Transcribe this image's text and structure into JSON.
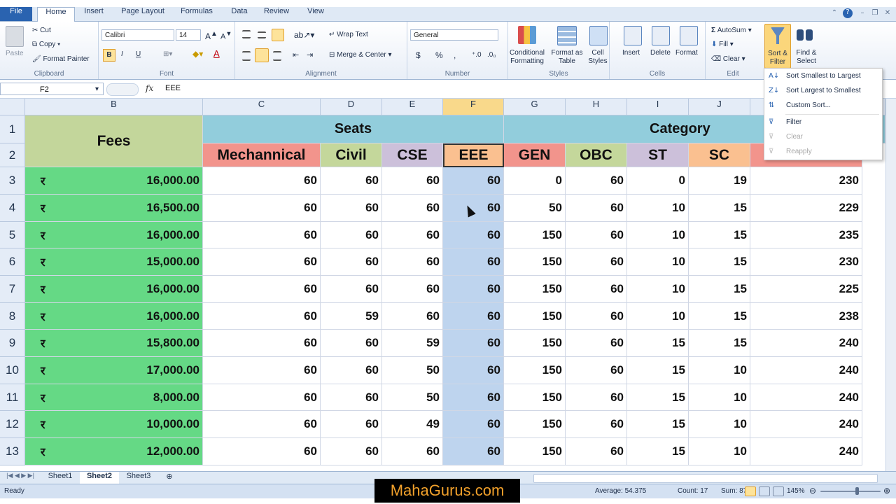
{
  "ribbon_tabs": [
    "File",
    "Home",
    "Insert",
    "Page Layout",
    "Formulas",
    "Data",
    "Review",
    "View"
  ],
  "clipboard": {
    "paste": "Paste",
    "cut": "Cut",
    "copy": "Copy",
    "format_painter": "Format Painter",
    "label": "Clipboard"
  },
  "font": {
    "name": "Calibri",
    "size": "14",
    "label": "Font",
    "bold": "B",
    "italic": "I",
    "underline": "U"
  },
  "alignment": {
    "wrap": "Wrap Text",
    "merge": "Merge & Center",
    "label": "Alignment"
  },
  "number": {
    "format": "General",
    "currency": "$",
    "percent": "%",
    "comma": ",",
    "label": "Number"
  },
  "styles": {
    "conditional": "Conditional Formatting",
    "format_table": "Format as Table",
    "cell_styles": "Cell Styles",
    "label": "Styles"
  },
  "cells": {
    "insert": "Insert",
    "delete": "Delete",
    "format": "Format",
    "label": "Cells"
  },
  "editing": {
    "autosum": "AutoSum",
    "fill": "Fill",
    "clear": "Clear",
    "sort_filter": "Sort & Filter",
    "find_select": "Find & Select",
    "label": "Edit"
  },
  "formula_bar": {
    "name_box": "F2",
    "fx": "fx",
    "content": "EEE"
  },
  "columns": [
    "B",
    "C",
    "D",
    "E",
    "F",
    "G",
    "H",
    "I",
    "J"
  ],
  "rows": [
    "1",
    "2",
    "3",
    "4",
    "5",
    "6",
    "7",
    "8",
    "9",
    "10",
    "11",
    "12",
    "13"
  ],
  "header_row1": {
    "fees": "Fees",
    "seats": "Seats",
    "category": "Category"
  },
  "header_row2": [
    "Mechannical",
    "Civil",
    "CSE",
    "EEE",
    "GEN",
    "OBC",
    "ST",
    "SC"
  ],
  "rupee": "र",
  "data_rows": [
    {
      "fee": "16,000.00",
      "c": "60",
      "d": "60",
      "e": "60",
      "f": "60",
      "g": "0",
      "h": "60",
      "i": "0",
      "j": "19",
      "k": "230"
    },
    {
      "fee": "16,500.00",
      "c": "60",
      "d": "60",
      "e": "60",
      "f": "60",
      "g": "50",
      "h": "60",
      "i": "10",
      "j": "15",
      "k": "229"
    },
    {
      "fee": "16,000.00",
      "c": "60",
      "d": "60",
      "e": "60",
      "f": "60",
      "g": "150",
      "h": "60",
      "i": "10",
      "j": "15",
      "k": "235"
    },
    {
      "fee": "15,000.00",
      "c": "60",
      "d": "60",
      "e": "60",
      "f": "60",
      "g": "150",
      "h": "60",
      "i": "10",
      "j": "15",
      "k": "230"
    },
    {
      "fee": "16,000.00",
      "c": "60",
      "d": "60",
      "e": "60",
      "f": "60",
      "g": "150",
      "h": "60",
      "i": "10",
      "j": "15",
      "k": "225"
    },
    {
      "fee": "16,000.00",
      "c": "60",
      "d": "59",
      "e": "60",
      "f": "60",
      "g": "150",
      "h": "60",
      "i": "10",
      "j": "15",
      "k": "238"
    },
    {
      "fee": "15,800.00",
      "c": "60",
      "d": "60",
      "e": "59",
      "f": "60",
      "g": "150",
      "h": "60",
      "i": "15",
      "j": "15",
      "k": "240"
    },
    {
      "fee": "17,000.00",
      "c": "60",
      "d": "60",
      "e": "50",
      "f": "60",
      "g": "150",
      "h": "60",
      "i": "15",
      "j": "10",
      "k": "240"
    },
    {
      "fee": "8,000.00",
      "c": "60",
      "d": "60",
      "e": "50",
      "f": "60",
      "g": "150",
      "h": "60",
      "i": "15",
      "j": "10",
      "k": "240"
    },
    {
      "fee": "10,000.00",
      "c": "60",
      "d": "60",
      "e": "49",
      "f": "60",
      "g": "150",
      "h": "60",
      "i": "15",
      "j": "10",
      "k": "240"
    },
    {
      "fee": "12,000.00",
      "c": "60",
      "d": "60",
      "e": "60",
      "f": "60",
      "g": "150",
      "h": "60",
      "i": "15",
      "j": "10",
      "k": "240"
    }
  ],
  "sort_menu": [
    "Sort Smallest to Largest",
    "Sort Largest to Smallest",
    "Custom Sort...",
    "Filter",
    "Clear",
    "Reapply"
  ],
  "sheets": [
    "Sheet1",
    "Sheet2",
    "Sheet3"
  ],
  "status": {
    "ready": "Ready",
    "average": "Average: 54.375",
    "count": "Count: 17",
    "sum": "Sum: 870",
    "zoom": "145%"
  },
  "watermark": "MahaGurus.com",
  "colors": {
    "fees_bg": "#c3d69b",
    "seats_bg": "#92cddc",
    "mech_bg": "#f2948c",
    "civil_bg": "#c4d79b",
    "cse_bg": "#ccc0da",
    "eee_bg": "#fac090",
    "gen_bg": "#f2948c",
    "obc_bg": "#c4d79b",
    "st_bg": "#ccc0da",
    "sc_bg": "#fac090",
    "fee_col": "#65d985",
    "selected": "#bed4ee"
  }
}
